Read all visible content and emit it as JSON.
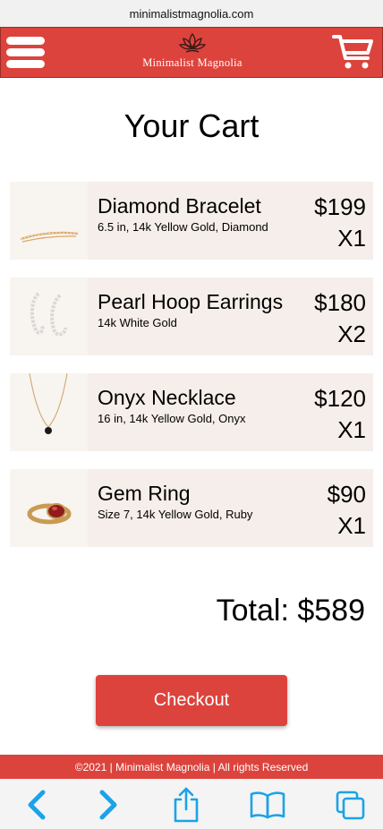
{
  "browser": {
    "url": "minimalistmagnolia.com"
  },
  "header": {
    "brand": "Minimalist Magnolia",
    "menu_icon": "hamburger-menu-icon",
    "logo_icon": "lotus-icon",
    "cart_icon": "shopping-cart-icon"
  },
  "page": {
    "title": "Your Cart"
  },
  "cart": {
    "items": [
      {
        "name": "Diamond Bracelet",
        "details": "6.5 in, 14k Yellow Gold, Diamond",
        "price": "$199",
        "qty": "X1",
        "image_icon": "bracelet-image"
      },
      {
        "name": "Pearl Hoop Earrings",
        "details": "14k White Gold",
        "price": "$180",
        "qty": "X2",
        "image_icon": "earrings-image"
      },
      {
        "name": "Onyx Necklace",
        "details": "16 in, 14k Yellow Gold, Onyx",
        "price": "$120",
        "qty": "X1",
        "image_icon": "necklace-image"
      },
      {
        "name": "Gem Ring",
        "details": "Size 7, 14k Yellow Gold, Ruby",
        "price": "$90",
        "qty": "X1",
        "image_icon": "ring-image"
      }
    ],
    "total": "Total: $589",
    "checkout_label": "Checkout"
  },
  "footer": {
    "text": "©2021 | Minimalist Magnolia | All rights Reserved"
  },
  "toolbar": {
    "icons": [
      "back-icon",
      "forward-icon",
      "share-icon",
      "bookmarks-icon",
      "tabs-icon"
    ],
    "accent": "#1aa3e8"
  },
  "colors": {
    "brand_red": "#dc433c",
    "item_bg": "#f6eeea"
  }
}
